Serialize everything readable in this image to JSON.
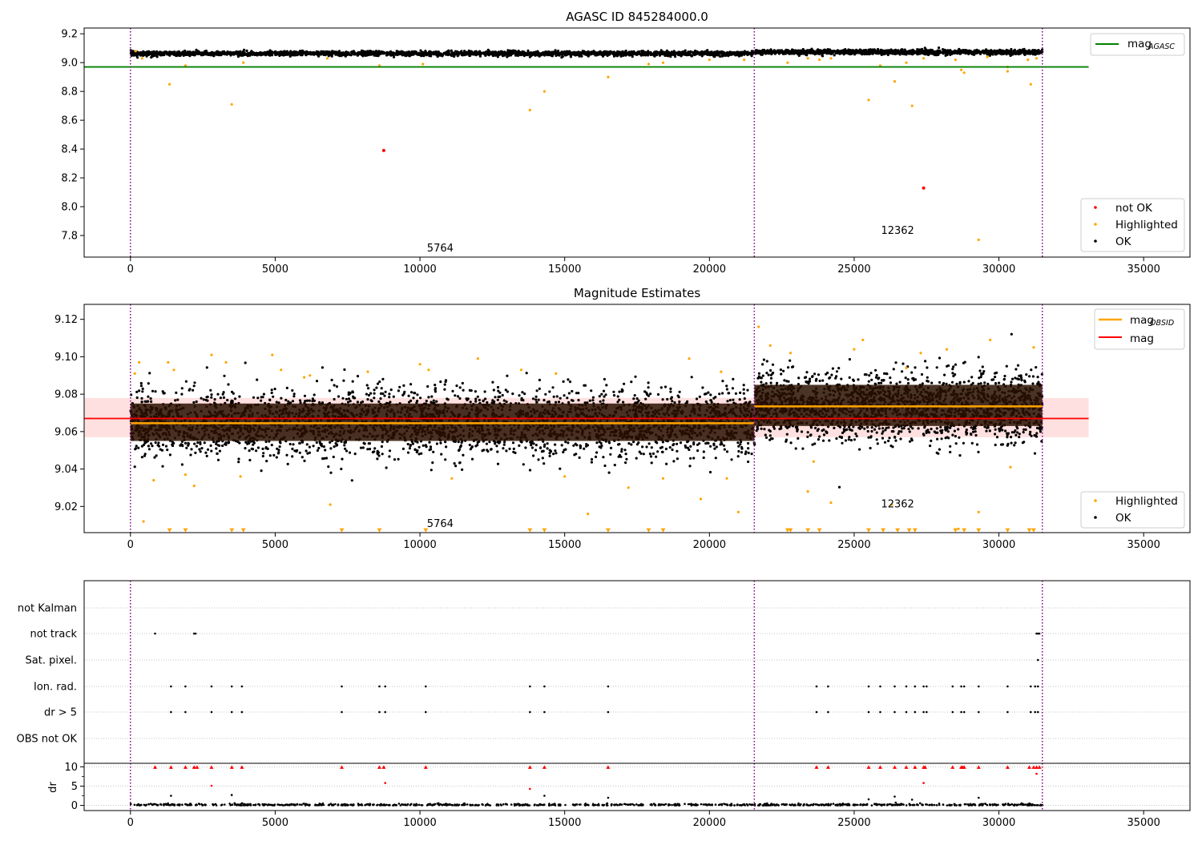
{
  "chart_data": [
    {
      "type": "scatter",
      "title": "AGASC ID 845284000.0",
      "xlim": [
        -1600,
        36600
      ],
      "ylim": [
        7.65,
        9.24
      ],
      "xticks": [
        0,
        5000,
        10000,
        15000,
        20000,
        25000,
        30000,
        35000
      ],
      "yticks": [
        7.8,
        8.0,
        8.2,
        8.4,
        8.6,
        8.8,
        9.0,
        9.2
      ],
      "ytick_labels": [
        "7.8",
        "8.0",
        "8.2",
        "8.4",
        "8.6",
        "8.8",
        "9.0",
        "9.2"
      ],
      "obs_boundaries": [
        0,
        21550,
        31500
      ],
      "obs_labels": [
        {
          "text": "5764",
          "x": 10700,
          "y": 7.69
        },
        {
          "text": "12362",
          "x": 26500,
          "y": 7.81
        }
      ],
      "mag_agasc": 8.97,
      "series": [
        {
          "name": "OK",
          "color": "#000000",
          "bands": [
            {
              "x0": 0,
              "x1": 21550,
              "center": 9.063,
              "spread": 0.008,
              "n": 2400
            },
            {
              "x0": 21550,
              "x1": 31500,
              "center": 9.073,
              "spread": 0.008,
              "n": 1400
            }
          ]
        },
        {
          "name": "Highlighted",
          "color": "#ffa500",
          "points": [
            [
              180,
              9.08
            ],
            [
              400,
              9.03
            ],
            [
              1350,
              8.85
            ],
            [
              1900,
              8.98
            ],
            [
              3500,
              8.71
            ],
            [
              3900,
              9.0
            ],
            [
              6800,
              9.03
            ],
            [
              8600,
              8.98
            ],
            [
              10100,
              8.99
            ],
            [
              13800,
              8.67
            ],
            [
              14300,
              8.8
            ],
            [
              16500,
              8.9
            ],
            [
              17900,
              8.99
            ],
            [
              18400,
              9.0
            ],
            [
              20000,
              9.02
            ],
            [
              21200,
              9.02
            ],
            [
              22700,
              9.0
            ],
            [
              23400,
              9.03
            ],
            [
              23800,
              9.02
            ],
            [
              24200,
              9.03
            ],
            [
              25500,
              8.74
            ],
            [
              25900,
              8.98
            ],
            [
              26400,
              8.87
            ],
            [
              26800,
              9.0
            ],
            [
              27000,
              8.7
            ],
            [
              27400,
              9.03
            ],
            [
              28500,
              9.02
            ],
            [
              28800,
              8.93
            ],
            [
              28700,
              8.95
            ],
            [
              29300,
              7.77
            ],
            [
              29600,
              9.04
            ],
            [
              30300,
              8.94
            ],
            [
              30300,
              8.97
            ],
            [
              31100,
              8.85
            ],
            [
              31000,
              9.02
            ],
            [
              31300,
              9.03
            ]
          ]
        },
        {
          "name": "not OK",
          "color": "#ff0000",
          "points": [
            [
              8750,
              8.39
            ],
            [
              27400,
              8.13
            ]
          ]
        }
      ],
      "legend_top": [
        {
          "label": "mag",
          "sub": "AGASC",
          "color": "#008000",
          "kind": "line"
        }
      ],
      "legend_bottom": [
        {
          "label": "not OK",
          "color": "#ff0000",
          "kind": "dot"
        },
        {
          "label": "Highlighted",
          "color": "#ffa500",
          "kind": "dot"
        },
        {
          "label": "OK",
          "color": "#000000",
          "kind": "dot"
        }
      ]
    },
    {
      "type": "scatter",
      "title": "Magnitude Estimates",
      "xlim": [
        -1600,
        36600
      ],
      "ylim": [
        9.006,
        9.128
      ],
      "xticks": [
        0,
        5000,
        10000,
        15000,
        20000,
        25000,
        30000,
        35000
      ],
      "yticks": [
        9.02,
        9.04,
        9.06,
        9.08,
        9.1,
        9.12
      ],
      "ytick_labels": [
        "9.02",
        "9.04",
        "9.06",
        "9.08",
        "9.10",
        "9.12"
      ],
      "obs_boundaries": [
        0,
        21550,
        31500
      ],
      "obs_labels": [
        {
          "text": "5764",
          "x": 10700,
          "y": 9.009
        },
        {
          "text": "12362",
          "x": 26500,
          "y": 9.0195
        }
      ],
      "mag_mean": 9.067,
      "mag_band": [
        9.057,
        9.078
      ],
      "obs_means": [
        {
          "x0": 0,
          "x1": 21550,
          "mag": 9.0645
        },
        {
          "x0": 21550,
          "x1": 31500,
          "mag": 9.0735
        }
      ],
      "dense_bands": [
        {
          "x0": 0,
          "x1": 21550,
          "y0": 9.055,
          "y1": 9.075
        },
        {
          "x0": 21550,
          "x1": 31500,
          "y0": 9.063,
          "y1": 9.085
        }
      ],
      "series": [
        {
          "name": "OK",
          "color": "#000000",
          "bands": [
            {
              "x0": 0,
              "x1": 21550,
              "center": 9.0645,
              "spread": 0.009,
              "n": 3200
            },
            {
              "x0": 21550,
              "x1": 31500,
              "center": 9.0735,
              "spread": 0.009,
              "n": 1900
            }
          ]
        },
        {
          "name": "Highlighted",
          "color": "#ffa500",
          "points": [
            [
              150,
              9.091
            ],
            [
              300,
              9.097
            ],
            [
              450,
              9.012
            ],
            [
              800,
              9.034
            ],
            [
              1300,
              9.097
            ],
            [
              1500,
              9.093
            ],
            [
              1900,
              9.037
            ],
            [
              2200,
              9.031
            ],
            [
              2800,
              9.101
            ],
            [
              3300,
              9.097
            ],
            [
              3800,
              9.036
            ],
            [
              4900,
              9.101
            ],
            [
              5200,
              9.093
            ],
            [
              6000,
              9.089
            ],
            [
              6200,
              9.09
            ],
            [
              6900,
              9.021
            ],
            [
              8200,
              9.092
            ],
            [
              10000,
              9.096
            ],
            [
              10300,
              9.093
            ],
            [
              11100,
              9.035
            ],
            [
              12000,
              9.099
            ],
            [
              13500,
              9.093
            ],
            [
              14700,
              9.091
            ],
            [
              15000,
              9.036
            ],
            [
              15800,
              9.016
            ],
            [
              17200,
              9.03
            ],
            [
              18400,
              9.035
            ],
            [
              19300,
              9.099
            ],
            [
              19700,
              9.024
            ],
            [
              20400,
              9.092
            ],
            [
              20600,
              9.035
            ],
            [
              21000,
              9.017
            ],
            [
              21700,
              9.116
            ],
            [
              22100,
              9.106
            ],
            [
              22800,
              9.102
            ],
            [
              23400,
              9.028
            ],
            [
              23600,
              9.044
            ],
            [
              24200,
              9.022
            ],
            [
              25000,
              9.104
            ],
            [
              25300,
              9.109
            ],
            [
              26300,
              9.021
            ],
            [
              26800,
              9.094
            ],
            [
              27300,
              9.102
            ],
            [
              28200,
              9.104
            ],
            [
              28600,
              9.008
            ],
            [
              29300,
              9.017
            ],
            [
              29700,
              9.109
            ],
            [
              30400,
              9.041
            ],
            [
              31200,
              9.105
            ]
          ]
        },
        {
          "name": "Highlighted (clipped)",
          "color": "#ffa500",
          "marker": "triangle",
          "points": [
            [
              1350,
              9.007
            ],
            [
              1900,
              9.007
            ],
            [
              3500,
              9.007
            ],
            [
              3900,
              9.007
            ],
            [
              7300,
              9.007
            ],
            [
              8600,
              9.007
            ],
            [
              10200,
              9.007
            ],
            [
              13800,
              9.007
            ],
            [
              14300,
              9.007
            ],
            [
              16500,
              9.007
            ],
            [
              17900,
              9.007
            ],
            [
              18400,
              9.007
            ],
            [
              22700,
              9.007
            ],
            [
              22800,
              9.007
            ],
            [
              23400,
              9.007
            ],
            [
              23800,
              9.007
            ],
            [
              25500,
              9.007
            ],
            [
              26000,
              9.007
            ],
            [
              26500,
              9.007
            ],
            [
              26900,
              9.007
            ],
            [
              27100,
              9.007
            ],
            [
              28500,
              9.007
            ],
            [
              28800,
              9.007
            ],
            [
              29300,
              9.007
            ],
            [
              30300,
              9.007
            ],
            [
              31050,
              9.007
            ],
            [
              31200,
              9.007
            ]
          ]
        }
      ],
      "legend_top": [
        {
          "label": "mag",
          "sub": "OBSID",
          "color": "#ffa500",
          "kind": "line"
        },
        {
          "label": "mag",
          "sub": "",
          "color": "#ff0000",
          "kind": "line"
        }
      ],
      "legend_bottom": [
        {
          "label": "Highlighted",
          "color": "#ffa500",
          "kind": "dot"
        },
        {
          "label": "OK",
          "color": "#000000",
          "kind": "dot"
        }
      ]
    },
    {
      "type": "scatter",
      "title": "",
      "xlim": [
        -1600,
        36600
      ],
      "xticks": [
        0,
        5000,
        10000,
        15000,
        20000,
        25000,
        30000,
        35000
      ],
      "obs_boundaries": [
        0,
        21550,
        31500
      ],
      "flag_rows": [
        "not Kalman",
        "not track",
        "Sat. pixel.",
        "Ion. rad.",
        "dr > 5",
        "OBS not OK"
      ],
      "flag_points": {
        "not track": [
          850,
          2200,
          2250,
          31300,
          31350,
          31400
        ],
        "Sat. pixel.": [
          31350
        ],
        "Ion. rad.": [
          1400,
          1900,
          2800,
          3500,
          3850,
          7300,
          8600,
          8800,
          10200,
          13800,
          14300,
          16500,
          23700,
          24100,
          25500,
          25900,
          26400,
          26800,
          27100,
          27400,
          27500,
          28400,
          28700,
          28800,
          29300,
          30300,
          31100,
          31250,
          31350
        ],
        "dr > 5": [
          1400,
          1900,
          2800,
          3500,
          3850,
          7300,
          8600,
          8800,
          10200,
          13800,
          14300,
          16500,
          23700,
          24100,
          25500,
          25900,
          26400,
          26800,
          27100,
          27400,
          27500,
          28400,
          28700,
          28800,
          29300,
          30300,
          31100,
          31250,
          31350
        ]
      },
      "dr_ylabel": "dr",
      "dr_ylim": [
        -0.5,
        10.5
      ],
      "dr_yticks": [
        0,
        5,
        10
      ],
      "dr_clipped": [
        850,
        1400,
        1900,
        2200,
        2300,
        2800,
        3500,
        3850,
        7300,
        8600,
        8750,
        10200,
        13800,
        14300,
        16500,
        23700,
        24100,
        25500,
        25900,
        26400,
        26800,
        27100,
        27400,
        27450,
        28400,
        28700,
        28750,
        28800,
        29300,
        30300,
        31050,
        31200,
        31300,
        31400
      ],
      "dr_points_red": [
        [
          2800,
          5.1
        ],
        [
          8800,
          5.8
        ],
        [
          13800,
          4.3
        ],
        [
          27400,
          5.8
        ],
        [
          31300,
          8.2
        ]
      ],
      "dr_points_black": [
        [
          1400,
          2.5
        ],
        [
          3500,
          2.7
        ],
        [
          14300,
          2.5
        ],
        [
          16500,
          2.0
        ],
        [
          25500,
          1.6
        ],
        [
          26400,
          2.3
        ],
        [
          27000,
          1.5
        ],
        [
          29300,
          2.0
        ]
      ],
      "dr_baseline": [
        {
          "x0": 0,
          "x1": 31500,
          "center": 0.15,
          "spread": 0.15,
          "n": 900
        }
      ]
    }
  ]
}
